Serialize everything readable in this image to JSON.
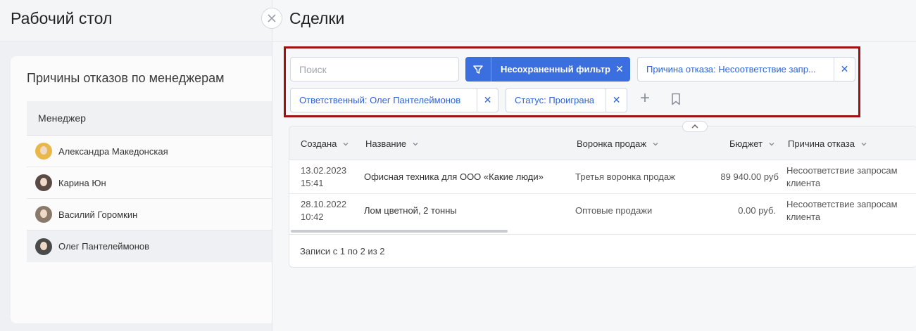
{
  "desktop": {
    "title": "Рабочий стол",
    "card_title": "Причины отказов по менеджерам",
    "column_header": "Менеджер",
    "managers": [
      {
        "name": "Александра Македонская",
        "avatar_color": "#e8b84a"
      },
      {
        "name": "Карина Юн",
        "avatar_color": "#5a4a44"
      },
      {
        "name": "Василий Горомкин",
        "avatar_color": "#8a7a6a"
      },
      {
        "name": "Олег Пантелеймонов",
        "avatar_color": "#4a4a4a"
      }
    ]
  },
  "panel": {
    "title": "Сделки",
    "search_placeholder": "Поиск",
    "unsaved_filter_label": "Несохраненный фильтр",
    "chips": [
      {
        "label": "Причина отказа: Несоответствие запр..."
      },
      {
        "label": "Ответственный: Олег Пантелеймонов"
      },
      {
        "label": "Статус: Проиграна"
      }
    ],
    "close_glyph": "✕",
    "plus_glyph": "+",
    "table": {
      "columns": [
        "Создана",
        "Название",
        "Воронка продаж",
        "Бюджет",
        "Причина отказа"
      ],
      "rows": [
        {
          "date": "13.02.2023",
          "time": "15:41",
          "name": "Офисная техника для ООО «Какие люди»",
          "funnel": "Третья воронка продаж",
          "budget": "89 940.00 руб",
          "reason1": "Несоответствие запросам",
          "reason2": "клиента"
        },
        {
          "date": "28.10.2022",
          "time": "10:42",
          "name": "Лом цветной, 2 тонны",
          "funnel": "Оптовые продажи",
          "budget": "0.00 руб.",
          "reason1": "Несоответствие запросам",
          "reason2": "клиента"
        }
      ],
      "footer": "Записи с 1 по 2 из 2"
    }
  },
  "colors": {
    "accent": "#3b6fe0",
    "chip_text": "#2f63d3",
    "highlight_border": "#a01010"
  }
}
